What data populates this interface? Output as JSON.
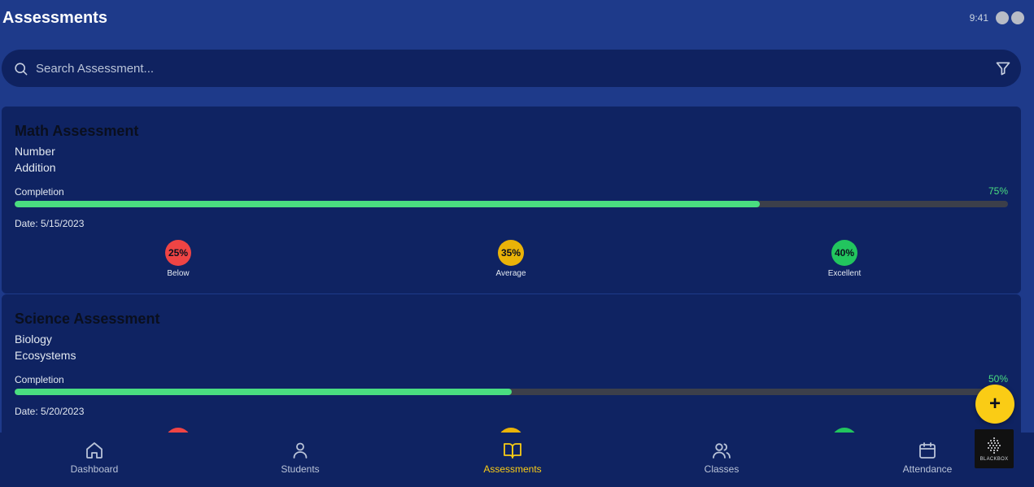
{
  "header": {
    "title": "Assessments",
    "time": "9:41"
  },
  "search": {
    "placeholder": "Search Assessment...",
    "value": ""
  },
  "assessments": [
    {
      "title": "Math Assessment",
      "subject": "Number",
      "topic": "Addition",
      "completion_label": "Completion",
      "completion": "75%",
      "completion_value": 75,
      "date": "Date: 5/15/2023",
      "stats": [
        {
          "value": "25%",
          "label": "Below",
          "color": "#ef4444"
        },
        {
          "value": "35%",
          "label": "Average",
          "color": "#eab308"
        },
        {
          "value": "40%",
          "label": "Excellent",
          "color": "#22c55e"
        }
      ]
    },
    {
      "title": "Science Assessment",
      "subject": "Biology",
      "topic": "Ecosystems",
      "completion_label": "Completion",
      "completion": "50%",
      "completion_value": 50,
      "date": "Date: 5/20/2023",
      "stats": [
        {
          "value": "",
          "label": "",
          "color": "#ef4444"
        },
        {
          "value": "",
          "label": "",
          "color": "#eab308"
        },
        {
          "value": "",
          "label": "",
          "color": "#22c55e"
        }
      ]
    }
  ],
  "fab": {
    "label": "+"
  },
  "nav": [
    {
      "label": "Dashboard",
      "icon": "home-icon",
      "active": false
    },
    {
      "label": "Students",
      "icon": "user-icon",
      "active": false
    },
    {
      "label": "Assessments",
      "icon": "book-icon",
      "active": true
    },
    {
      "label": "Classes",
      "icon": "users-icon",
      "active": false
    },
    {
      "label": "Attendance",
      "icon": "calendar-icon",
      "active": false
    }
  ],
  "badge": {
    "text": "BLACKBOX"
  },
  "colors": {
    "background": "#1e3a8a",
    "card": "#0f2362",
    "accent": "#facc15",
    "progress": "#4ade80"
  }
}
